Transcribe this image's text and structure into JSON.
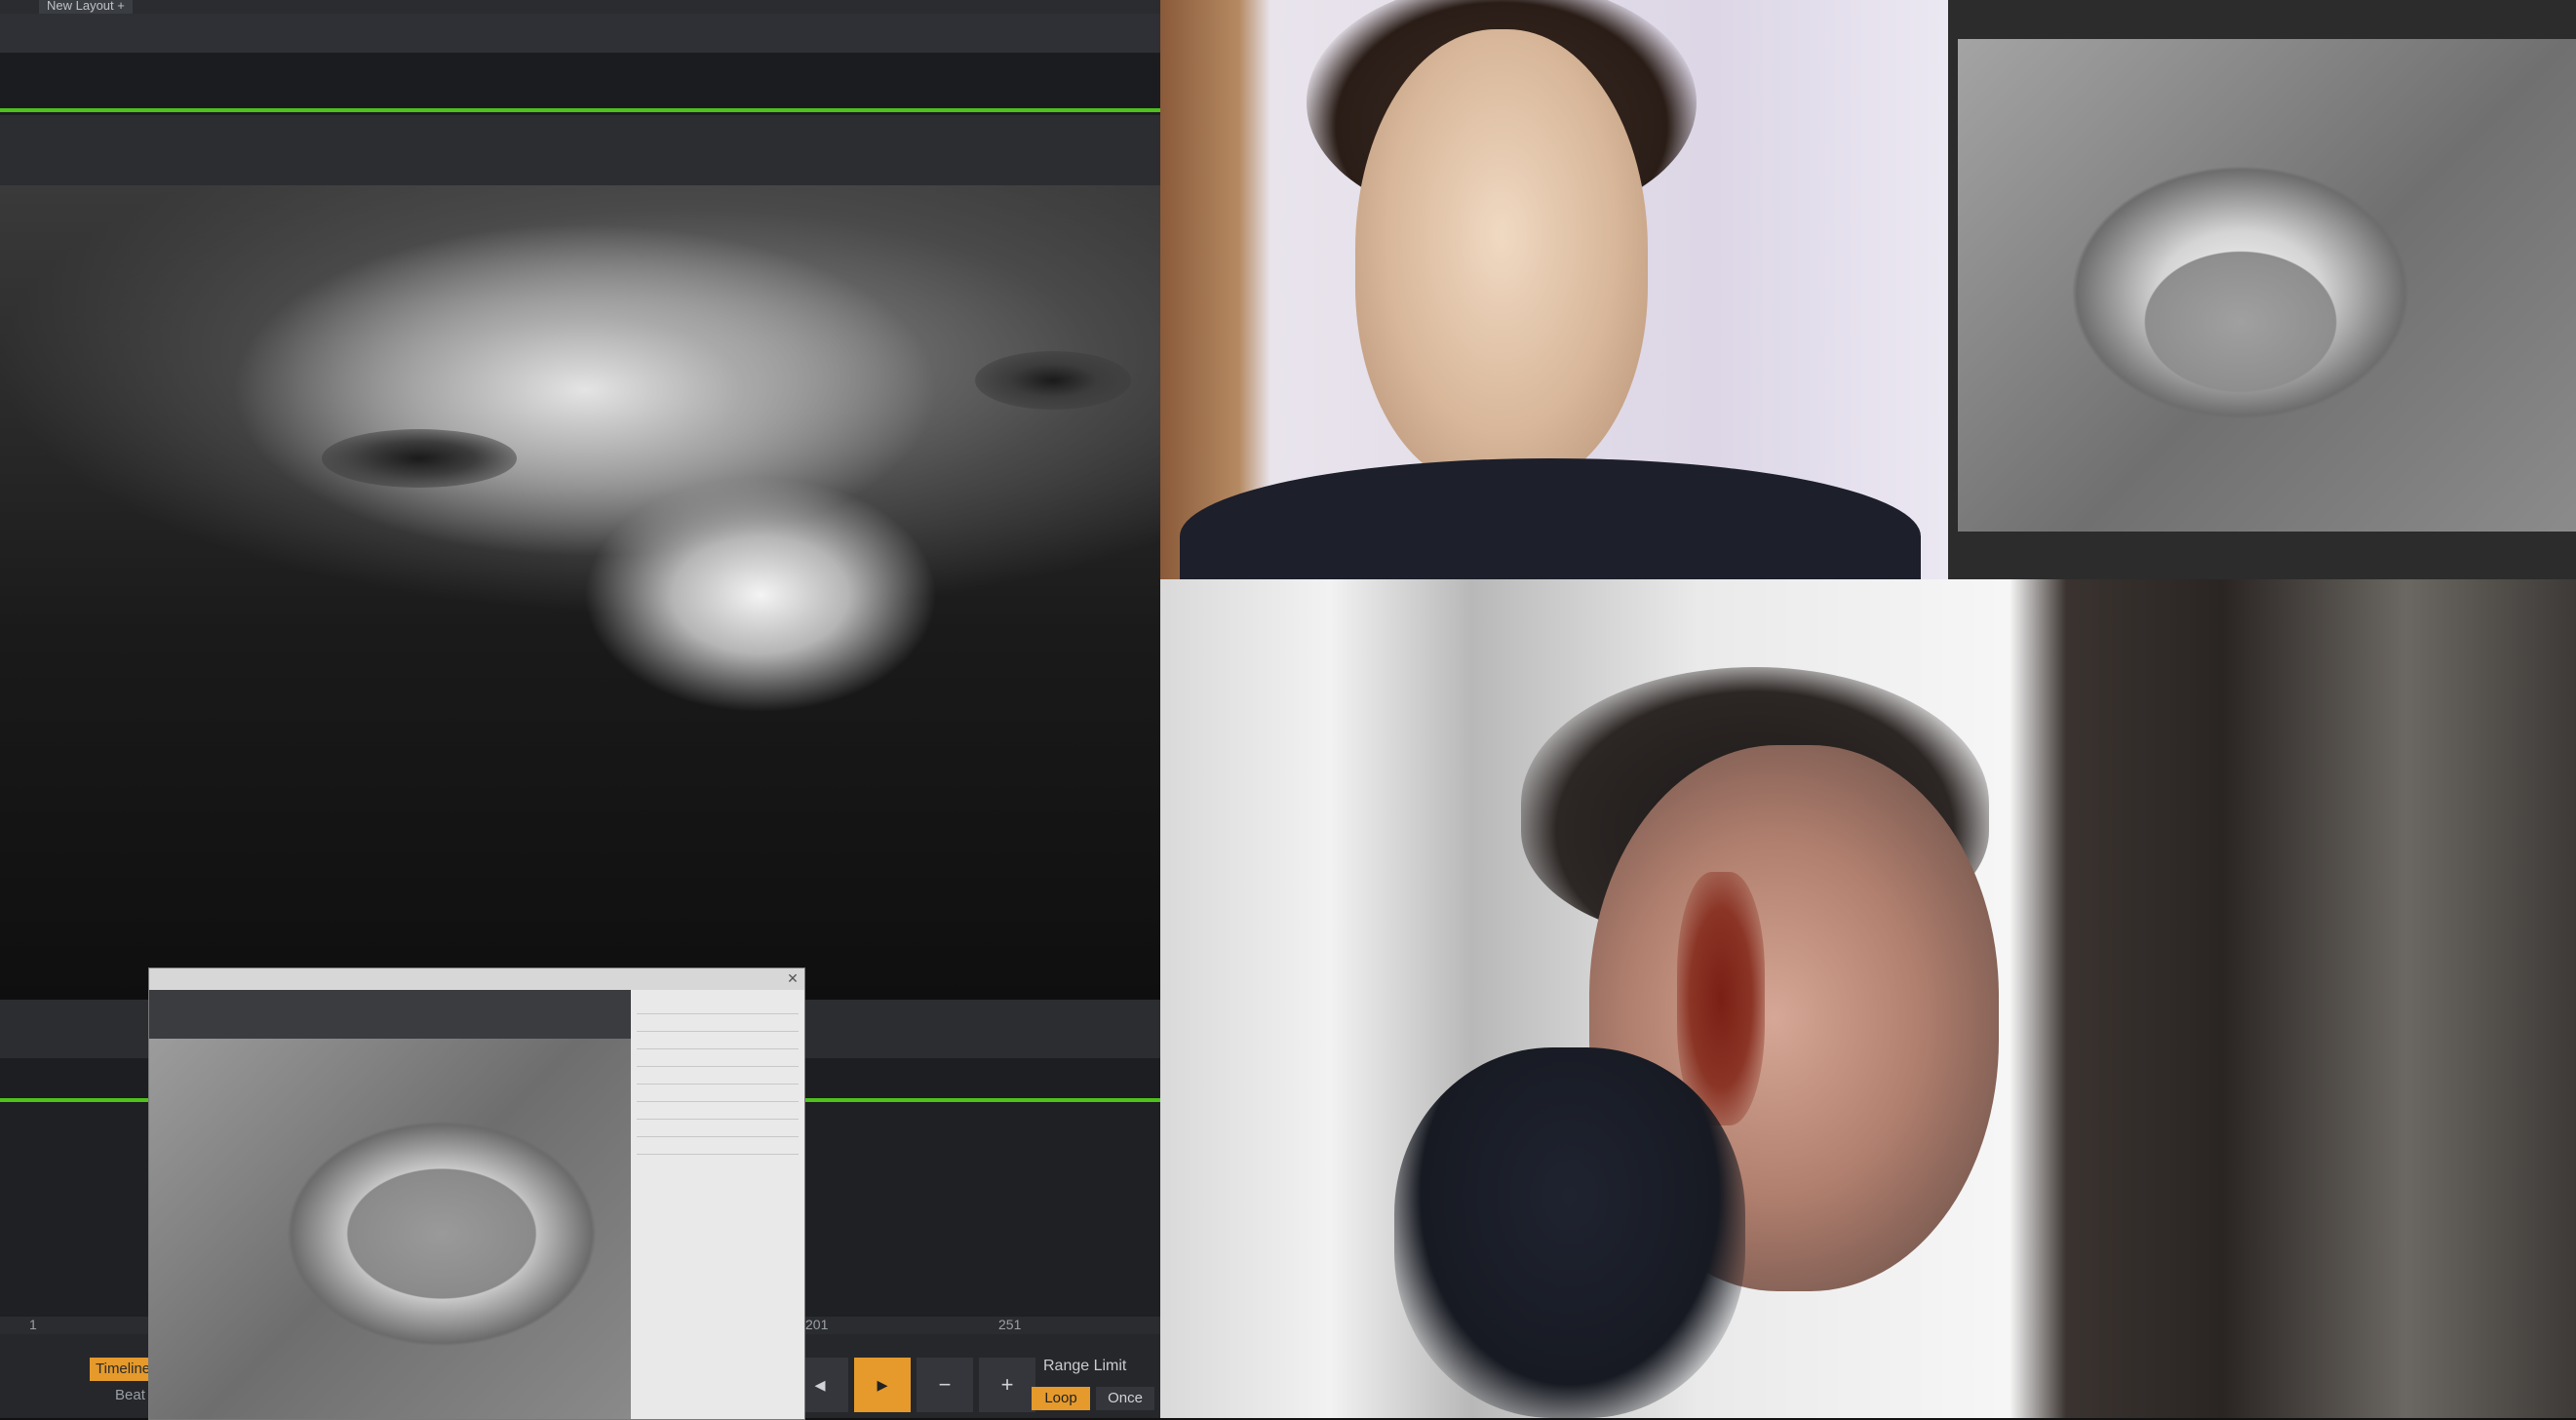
{
  "editor": {
    "layout_tab_label": "New Layout +",
    "timeline": {
      "ticks": [
        "1",
        "201",
        "251"
      ],
      "tab_label": "Timeline",
      "sub_label": "Beat",
      "buttons": [
        "◂",
        "▸",
        "−",
        "+"
      ],
      "range_limit_label": "Range Limit",
      "loop_label": "Loop",
      "once_label": "Once"
    }
  },
  "video_grid": {
    "tiles": [
      "main-camera",
      "participant-top",
      "processed-feed",
      "participant-bottom"
    ]
  }
}
